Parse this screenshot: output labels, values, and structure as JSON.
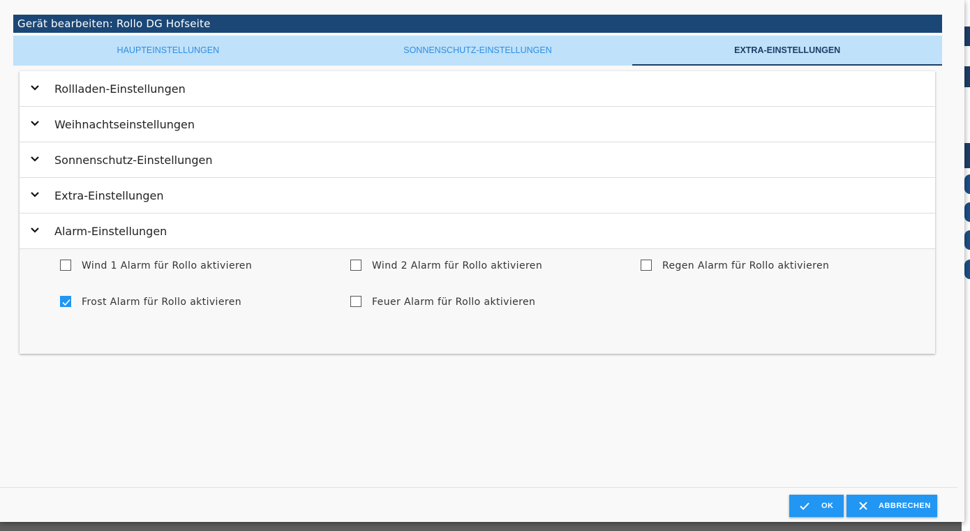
{
  "dialog": {
    "title": "Gerät bearbeiten: Rollo DG Hofseite"
  },
  "tabs": [
    {
      "label": "HAUPTEINSTELLUNGEN",
      "active": false
    },
    {
      "label": "SONNENSCHUTZ-EINSTELLUNGEN",
      "active": false
    },
    {
      "label": "EXTRA-EINSTELLUNGEN",
      "active": true
    }
  ],
  "accordion": {
    "sections": [
      {
        "label": "Rollladen-Einstellungen",
        "expanded": false
      },
      {
        "label": "Weihnachtseinstellungen",
        "expanded": false
      },
      {
        "label": "Sonnenschutz-Einstellungen",
        "expanded": false
      },
      {
        "label": "Extra-Einstellungen",
        "expanded": false
      },
      {
        "label": "Alarm-Einstellungen",
        "expanded": true
      }
    ],
    "alarm_options": [
      {
        "label": "Wind 1 Alarm für Rollo aktivieren",
        "checked": false
      },
      {
        "label": "Wind 2 Alarm für Rollo aktivieren",
        "checked": false
      },
      {
        "label": "Regen Alarm für Rollo aktivieren",
        "checked": false
      },
      {
        "label": "Frost Alarm für Rollo aktivieren",
        "checked": true
      },
      {
        "label": "Feuer Alarm für Rollo aktivieren",
        "checked": false
      }
    ]
  },
  "footer": {
    "ok_label": "OK",
    "cancel_label": "ABBRECHEN",
    "ok_icon": "check-icon",
    "cancel_icon": "close-icon"
  },
  "colors": {
    "title_bar": "#1b4776",
    "tabs_bg": "#bfe1fa",
    "tab_text": "#2f8ee0",
    "active_tab": "#1c3e66",
    "accent": "#2196f3"
  }
}
